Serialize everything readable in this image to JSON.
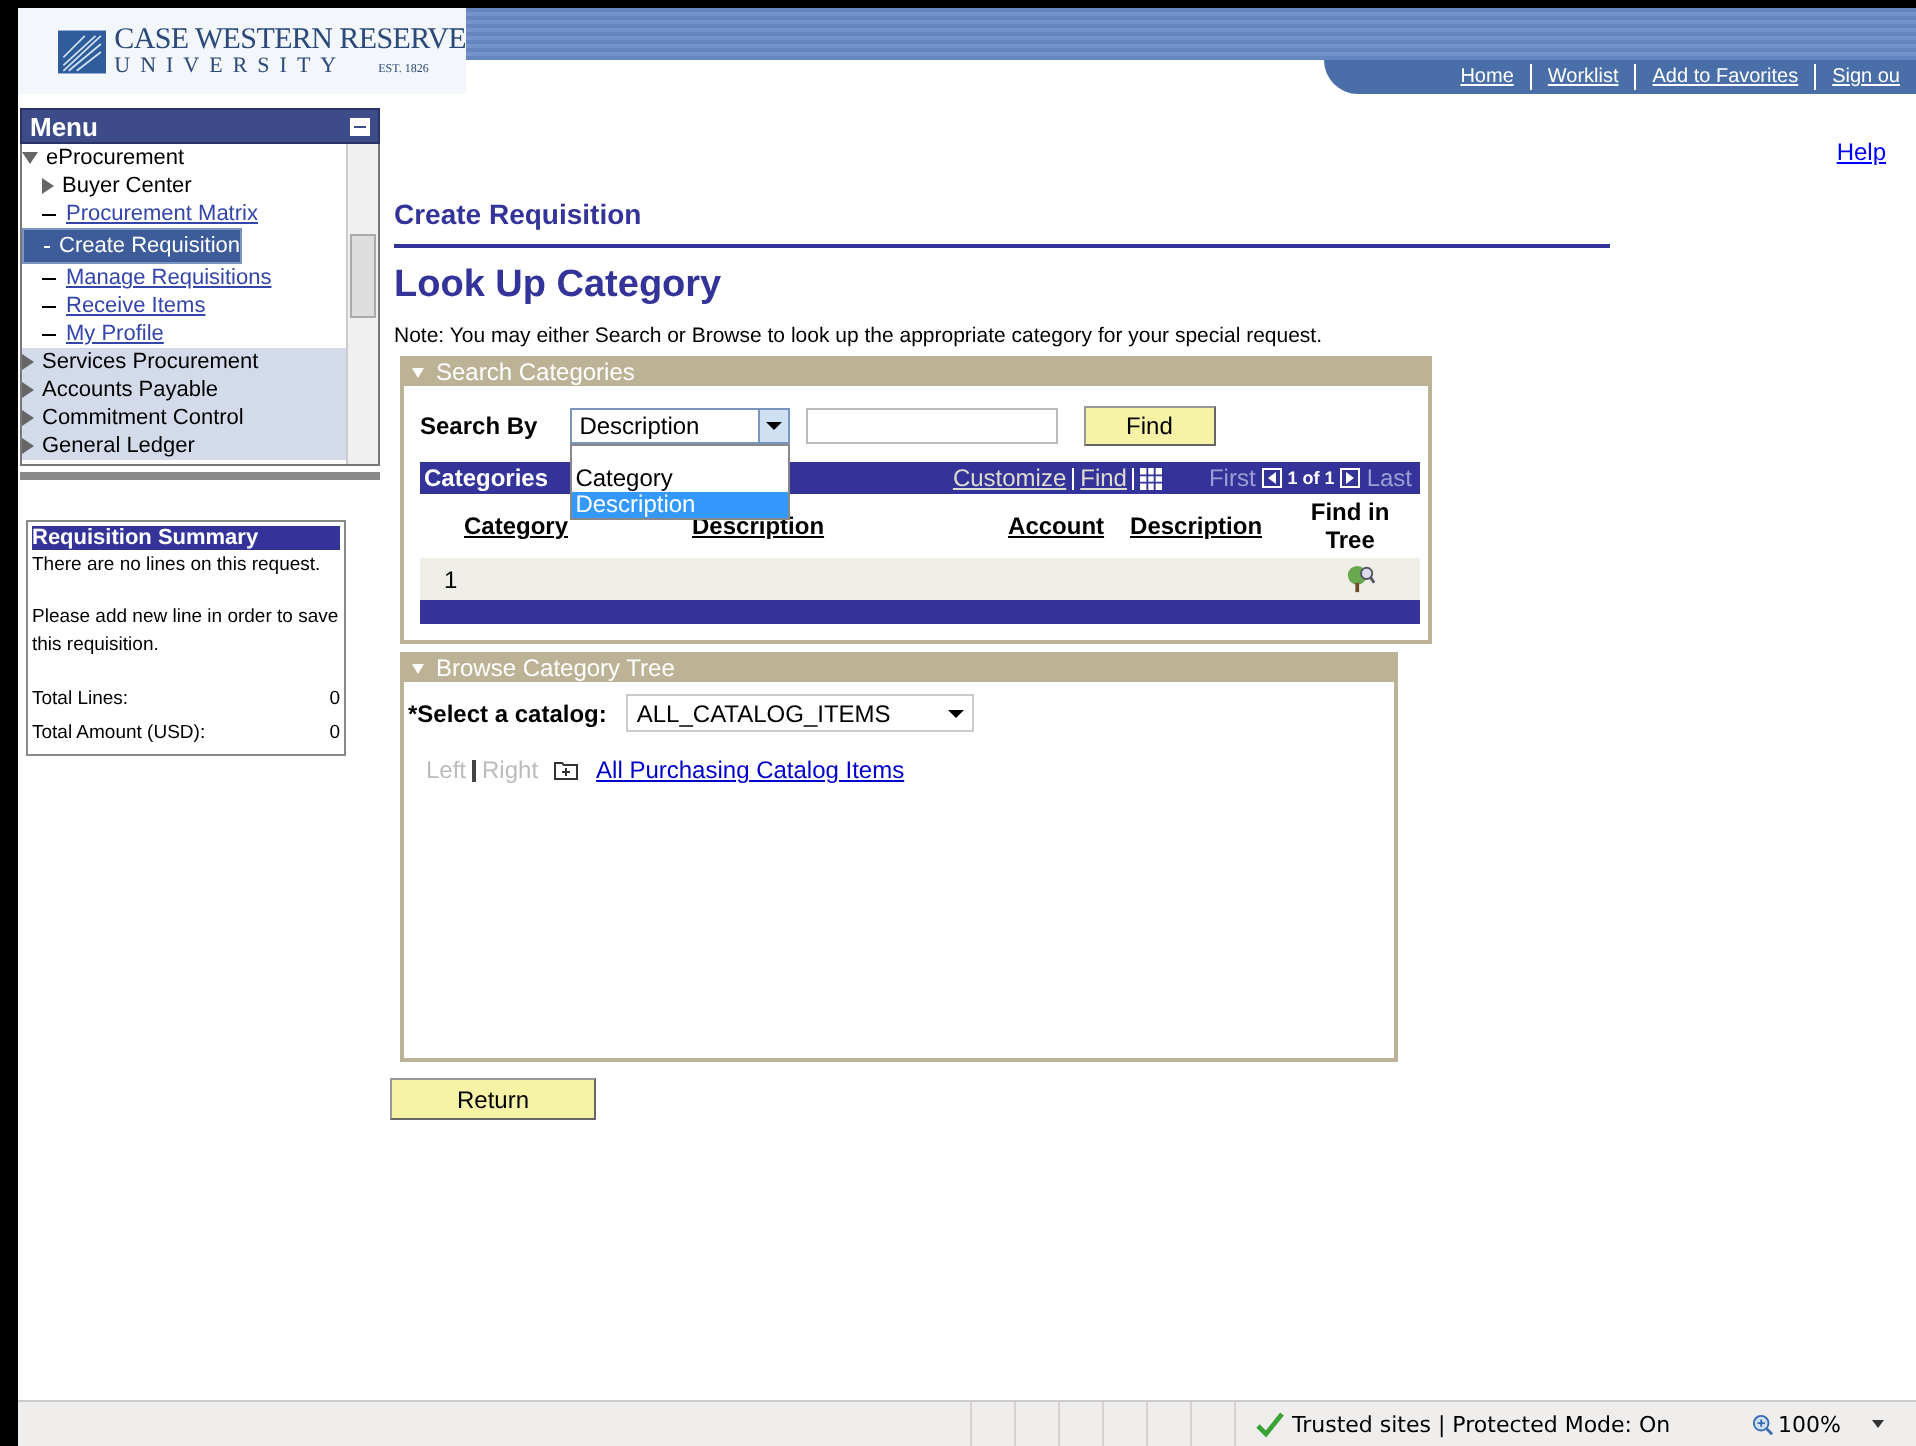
{
  "header": {
    "logo": {
      "name": "CASE WESTERN RESERVE",
      "sub": "UNIVERSITY",
      "est": "EST. 1826"
    },
    "nav": [
      {
        "label": "Home"
      },
      {
        "label": "Worklist"
      },
      {
        "label": "Add to Favorites"
      },
      {
        "label": "Sign ou"
      }
    ]
  },
  "menu": {
    "title": "Menu",
    "items": [
      {
        "kind": "folder",
        "label": "eProcurement",
        "expanded": true,
        "children": [
          {
            "kind": "folder",
            "label": "Buyer Center",
            "expanded": false
          },
          {
            "kind": "link",
            "label": "Procurement Matrix",
            "selected": false
          },
          {
            "kind": "link",
            "label": "Create Requisition",
            "selected": true
          },
          {
            "kind": "link",
            "label": "Manage Requisitions",
            "selected": false
          },
          {
            "kind": "link",
            "label": "Receive Items",
            "selected": false
          },
          {
            "kind": "link",
            "label": "My Profile",
            "selected": false
          }
        ]
      },
      {
        "kind": "folder",
        "label": "Services Procurement",
        "expanded": false
      },
      {
        "kind": "folder",
        "label": "Accounts Payable",
        "expanded": false
      },
      {
        "kind": "folder",
        "label": "Commitment Control",
        "expanded": false
      },
      {
        "kind": "folder",
        "label": "General Ledger",
        "expanded": false
      }
    ]
  },
  "summary": {
    "title": "Requisition Summary",
    "messages": [
      "There are no lines on this request.",
      "Please add new line in order to save this requisition."
    ],
    "totals": [
      {
        "label": "Total Lines:",
        "value": "0"
      },
      {
        "label": "Total Amount (USD):",
        "value": "0"
      }
    ]
  },
  "help": "Help",
  "page_title": "Create Requisition",
  "heading": "Look Up Category",
  "note": "Note: You may either Search or Browse to look up the appropriate category for your special request.",
  "search": {
    "title": "Search Categories",
    "label": "Search By",
    "select": {
      "value": "Description",
      "open": true,
      "options": [
        {
          "label": "Category",
          "selected": false
        },
        {
          "label": "Description",
          "selected": true
        }
      ]
    },
    "find_button": "Find",
    "grid": {
      "title": "Categories",
      "links": [
        "Customize",
        "Find"
      ],
      "first": "First",
      "range": "1 of 1",
      "last": "Last",
      "columns": [
        "Category",
        "Description",
        "Account",
        "Description",
        "Find in Tree"
      ],
      "rows": [
        {
          "number": "1"
        }
      ]
    }
  },
  "browse": {
    "title": "Browse Category Tree",
    "label": "*Select a catalog:",
    "value": "ALL_CATALOG_ITEMS",
    "left": {
      "label": "Left",
      "disabled": true
    },
    "right": {
      "label": "Right",
      "disabled": true
    },
    "node": "All Purchasing Catalog Items"
  },
  "return_button": "Return",
  "status_bar": {
    "zone": "Trusted sites | Protected Mode: On",
    "zoom": "100%"
  }
}
